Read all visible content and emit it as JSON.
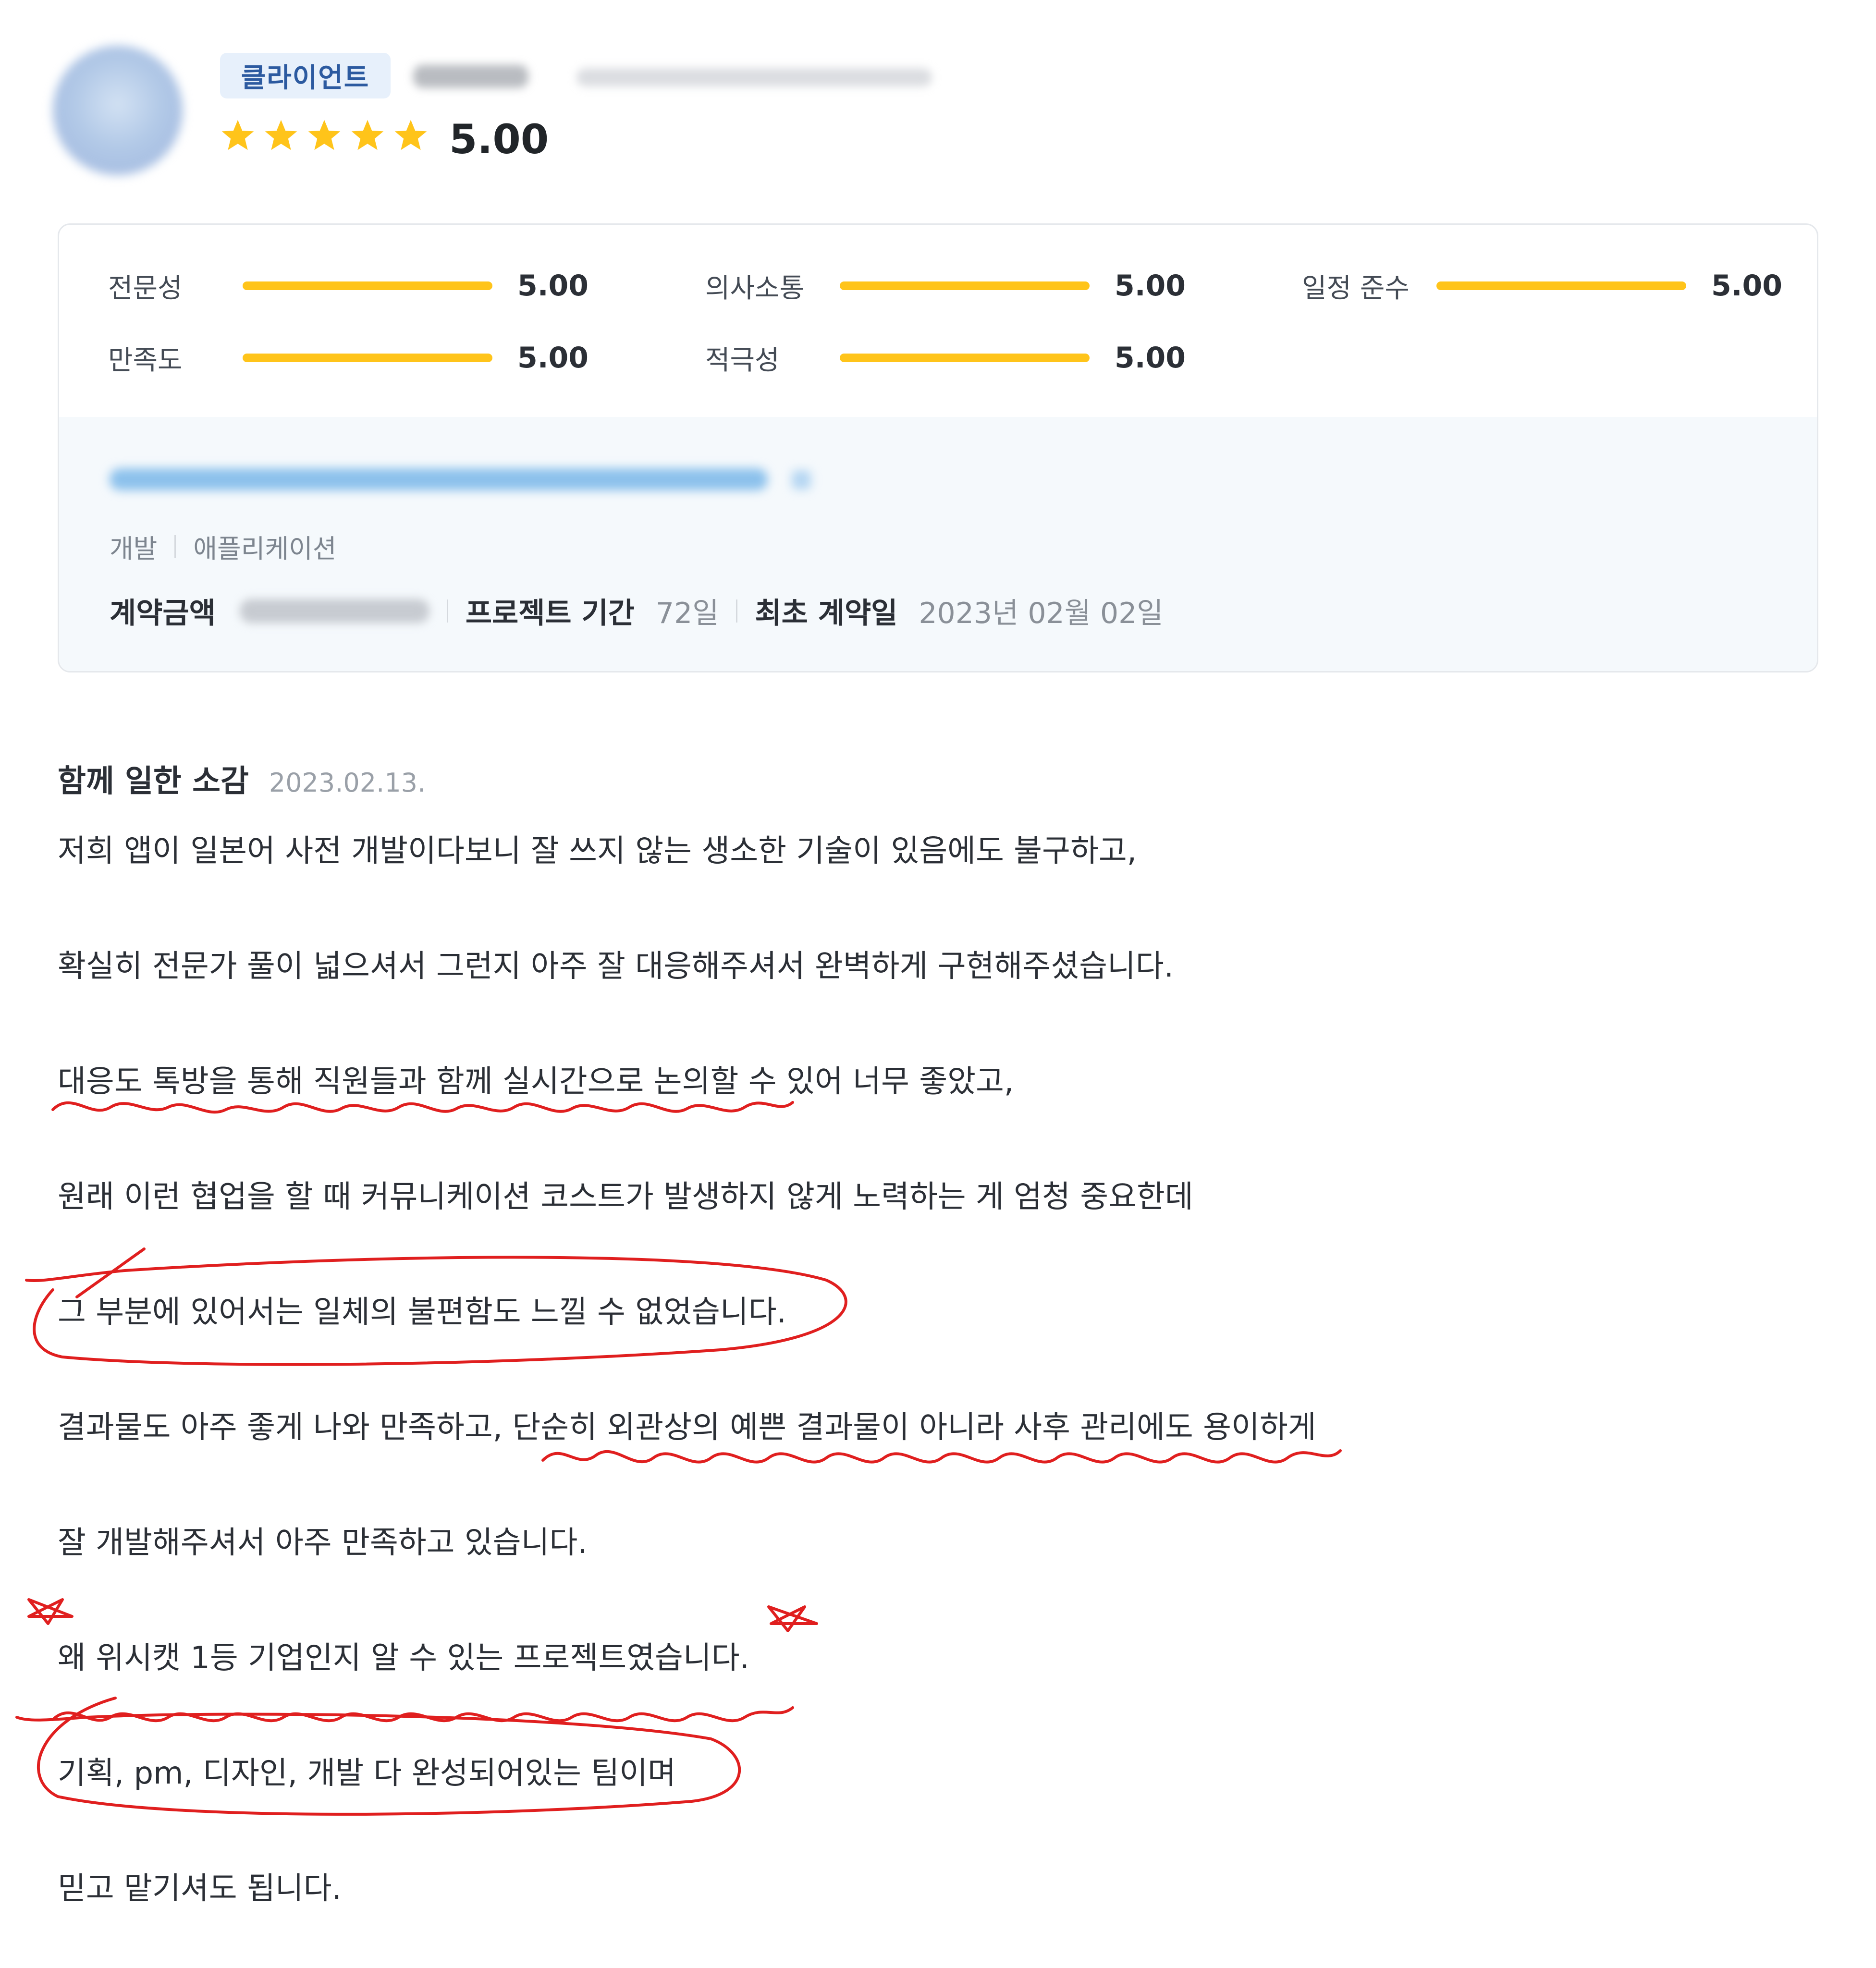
{
  "header": {
    "badge": "클라이언트",
    "rating": 5.0,
    "rating_text": "5.00",
    "star_color": "#ffc41a",
    "avatar_icon": "avatar"
  },
  "metrics": [
    {
      "label": "전문성",
      "value": "5.00",
      "fill": 1.0
    },
    {
      "label": "의사소통",
      "value": "5.00",
      "fill": 1.0
    },
    {
      "label": "일정 준수",
      "value": "5.00",
      "fill": 1.0
    },
    {
      "label": "만족도",
      "value": "5.00",
      "fill": 1.0
    },
    {
      "label": "적극성",
      "value": "5.00",
      "fill": 1.0
    }
  ],
  "project": {
    "category": "개발",
    "subcategory": "애플리케이션",
    "contract_label": "계약금액",
    "period_label": "프로젝트 기간",
    "period_value": "72일",
    "first_contract_label": "최초 계약일",
    "first_contract_value": "2023년 02월 02일"
  },
  "review": {
    "heading": "함께 일한 소감",
    "date": "2023.02.13.",
    "lines": [
      "저희 앱이 일본어 사전 개발이다보니 잘 쓰지 않는 생소한 기술이 있음에도 불구하고,",
      "확실히 전문가 풀이 넓으셔서 그런지 아주 잘 대응해주셔서 완벽하게 구현해주셨습니다.",
      "대응도 톡방을 통해 직원들과 함께 실시간으로 논의할 수 있어 너무 좋았고,",
      "원래 이런 협업을 할 때 커뮤니케이션 코스트가 발생하지 않게 노력하는 게 엄청 중요한데",
      "그 부분에 있어서는 일체의 불편함도 느낄 수 없었습니다.",
      "결과물도 아주 좋게 나와 만족하고, 단순히 외관상의 예쁜 결과물이 아니라 사후 관리에도 용이하게",
      "잘 개발해주셔서 아주 만족하고 있습니다.",
      "왜 위시캣 1등 기업인지 알 수 있는 프로젝트였습니다.",
      "기획, pm, 디자인, 개발 다 완성되어있는 팀이며",
      "믿고 맡기셔도 됩니다."
    ]
  },
  "annotation_color": "#e01f1f"
}
